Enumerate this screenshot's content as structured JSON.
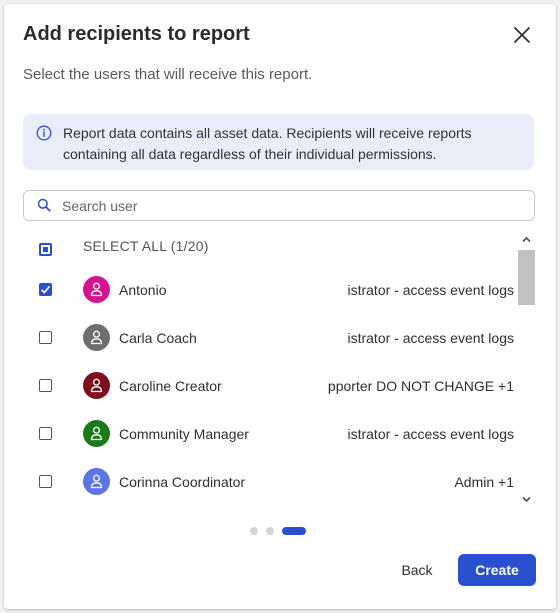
{
  "dialog": {
    "title": "Add recipients to report",
    "subtitle": "Select the users that will receive this report.",
    "close_icon": "close-icon"
  },
  "info": {
    "icon": "info-icon",
    "text": "Report data contains all asset data. Recipients will receive reports containing all data regardless of their individual permissions."
  },
  "search": {
    "icon": "search-icon",
    "placeholder": "Search user",
    "value": ""
  },
  "list": {
    "select_all": {
      "label": "SELECT ALL (1/20)",
      "state": "partial"
    },
    "users": [
      {
        "name": "Antonio",
        "role": "istrator - access event logs",
        "checked": true,
        "avatar_color": "#d6148f"
      },
      {
        "name": "Carla Coach",
        "role": "istrator - access event logs",
        "checked": false,
        "avatar_color": "#6e6e6e"
      },
      {
        "name": "Caroline Creator",
        "role": "pporter DO NOT CHANGE +1",
        "checked": false,
        "avatar_color": "#7d0f1d"
      },
      {
        "name": "Community Manager",
        "role": "istrator - access event logs",
        "checked": false,
        "avatar_color": "#1a7a1a"
      },
      {
        "name": "Corinna Coordinator",
        "role": "Admin +1",
        "checked": false,
        "avatar_color": "#5d74e6"
      }
    ]
  },
  "pagination": {
    "total_steps": 3,
    "current_step": 3
  },
  "footer": {
    "back_label": "Back",
    "create_label": "Create"
  },
  "colors": {
    "accent": "#2a4fcf",
    "info_bg": "#e9edfa"
  }
}
